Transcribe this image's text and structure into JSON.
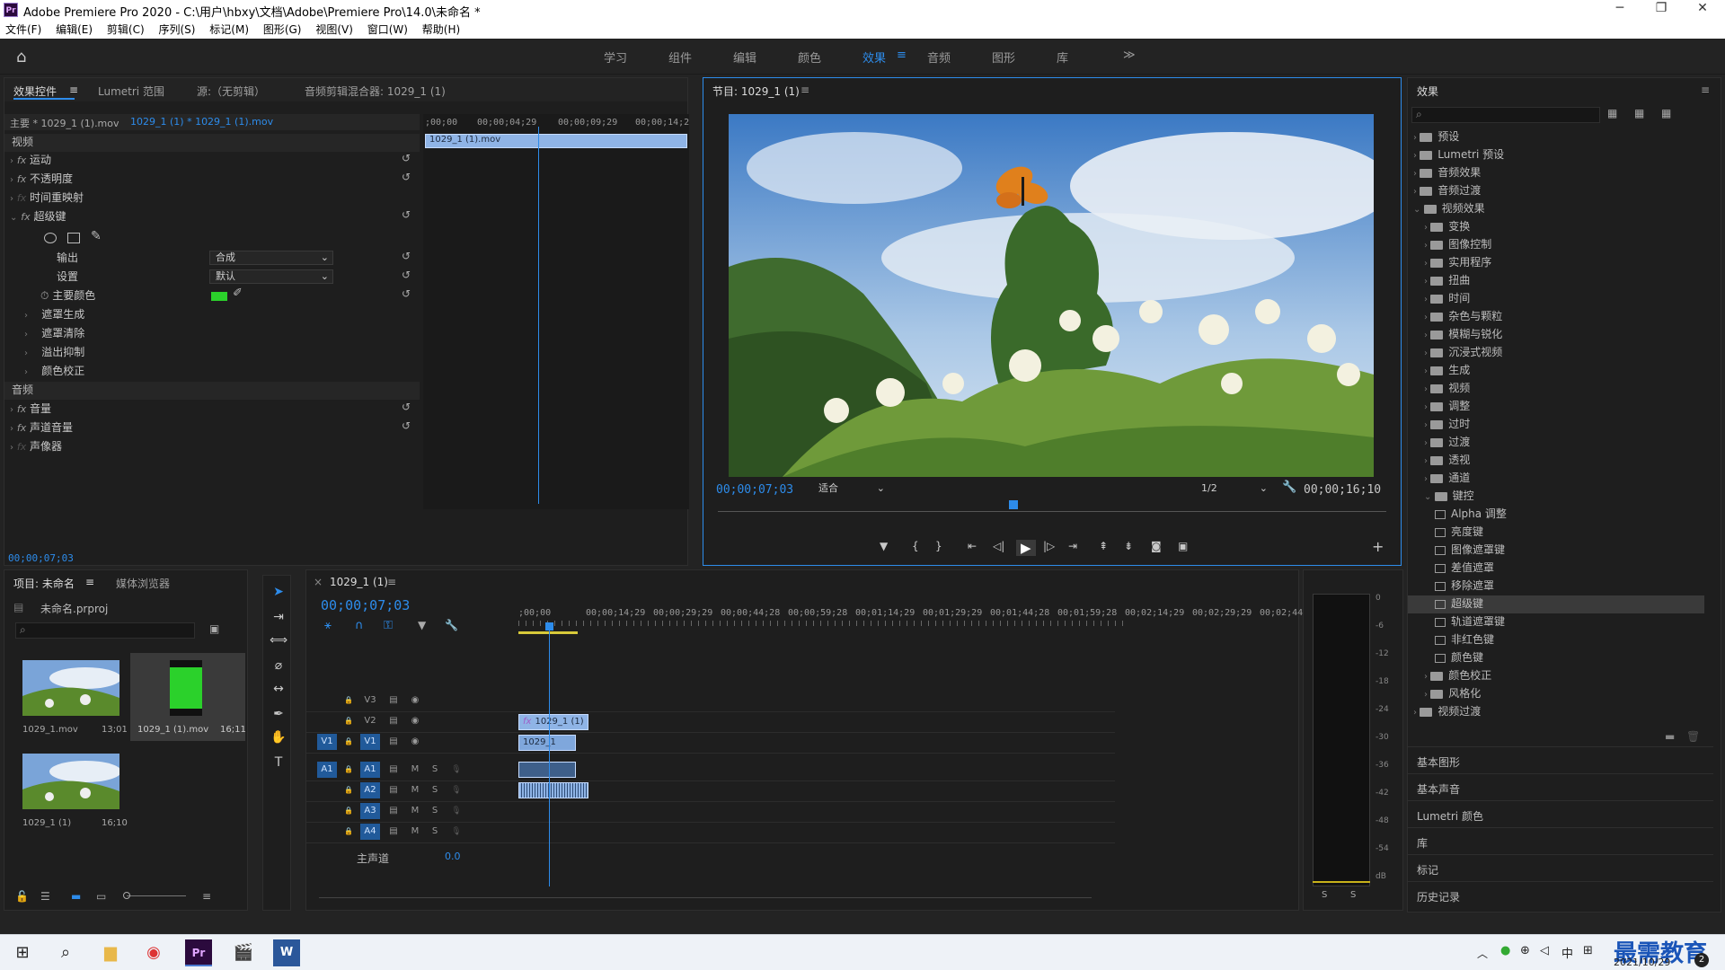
{
  "window": {
    "title": "Adobe Premiere Pro 2020 - C:\\用户\\hbxy\\文档\\Adobe\\Premiere Pro\\14.0\\未命名 *",
    "minimize": "─",
    "maximize": "❐",
    "close": "✕"
  },
  "menu": [
    "文件(F)",
    "编辑(E)",
    "剪辑(C)",
    "序列(S)",
    "标记(M)",
    "图形(G)",
    "视图(V)",
    "窗口(W)",
    "帮助(H)"
  ],
  "workspaces": [
    "学习",
    "组件",
    "编辑",
    "颜色",
    "效果",
    "音频",
    "图形",
    "库"
  ],
  "workspace_active": "效果",
  "workspace_menu": "≡",
  "workspace_more": "≫",
  "effect_controls": {
    "tabs": [
      "效果控件",
      "Lumetri 范围",
      "源:（无剪辑）",
      "音频剪辑混合器: 1029_1 (1)"
    ],
    "tab_menu": "≡",
    "master": "主要 * 1029_1 (1).mov",
    "sequence": "1029_1 (1) * 1029_1 (1).mov",
    "ruler": [
      ";00;00",
      "00;00;04;29",
      "00;00;09;29",
      "00;00;14;2"
    ],
    "clip_label": "1029_1 (1).mov",
    "video_header": "视频",
    "rows_video": [
      "运动",
      "不透明度",
      "时间重映射",
      "超级键"
    ],
    "output_label": "输出",
    "output_value": "合成",
    "setting_label": "设置",
    "setting_value": "默认",
    "key_color_label": "主要颜色",
    "sub_groups": [
      "遮罩生成",
      "遮罩清除",
      "溢出抑制",
      "颜色校正"
    ],
    "audio_header": "音频",
    "rows_audio": [
      "音量",
      "声道音量",
      "声像器"
    ],
    "timecode": "00;00;07;03",
    "key_color": "#2bd12b"
  },
  "program": {
    "title": "节目: 1029_1 (1)",
    "timecode": "00;00;07;03",
    "fit": "适合",
    "quality": "1/2",
    "duration": "00;00;16;10",
    "controls": [
      "marker-icon",
      "in-icon",
      "out-icon",
      "goto-in-icon",
      "step-back-icon",
      "play-icon",
      "step-forward-icon",
      "goto-out-icon",
      "lift-icon",
      "extract-icon",
      "export-frame-icon",
      "compare-icon"
    ]
  },
  "effects": {
    "title": "效果",
    "top_items": [
      "预设",
      "Lumetri 预设",
      "音频效果",
      "音频过渡",
      "视频效果"
    ],
    "video_effects": [
      "变换",
      "图像控制",
      "实用程序",
      "扭曲",
      "时间",
      "杂色与颗粒",
      "模糊与锐化",
      "沉浸式视频",
      "生成",
      "视频",
      "调整",
      "过时",
      "过渡",
      "透视",
      "通道",
      "键控"
    ],
    "keying": [
      "Alpha 调整",
      "亮度键",
      "图像遮罩键",
      "差值遮罩",
      "移除遮罩",
      "超级键",
      "轨道遮罩键",
      "非红色键",
      "颜色键"
    ],
    "keying_selected": "超级键",
    "after": [
      "颜色校正",
      "风格化"
    ],
    "last": "视频过渡",
    "side_panels": [
      "基本图形",
      "基本声音",
      "Lumetri 颜色",
      "库",
      "标记",
      "历史记录"
    ]
  },
  "project": {
    "tabs": [
      "项目: 未命名",
      "媒体浏览器"
    ],
    "file": "未命名.prproj",
    "items": [
      {
        "name": "1029_1.mov",
        "dur": "13;01"
      },
      {
        "name": "1029_1 (1).mov",
        "dur": "16;11"
      },
      {
        "name": "1029_1 (1)",
        "dur": "16;10"
      }
    ]
  },
  "timeline": {
    "tab": "1029_1 (1)",
    "close": "×",
    "timecode": "00;00;07;03",
    "ruler": [
      ";00;00",
      "00;00;14;29",
      "00;00;29;29",
      "00;00;44;28",
      "00;00;59;28",
      "00;01;14;29",
      "00;01;29;29",
      "00;01;44;28",
      "00;01;59;28",
      "00;02;14;29",
      "00;02;29;29",
      "00;02;44;"
    ],
    "video_tracks": [
      "V3",
      "V2",
      "V1"
    ],
    "audio_tracks": [
      "A1",
      "A2",
      "A3",
      "A4"
    ],
    "src_v": "V1",
    "src_a": "A1",
    "master": "主声道",
    "master_val": "0.0",
    "clip_v2": "1029_1 (1)",
    "clip_v1": "1029_1",
    "fx_badge": "fx",
    "track_m": "M",
    "track_s": "S"
  },
  "meters": [
    "0",
    "-6",
    "-12",
    "-18",
    "-24",
    "-30",
    "-36",
    "-42",
    "-48",
    "-54",
    "dB"
  ],
  "meter_solo": [
    "S",
    "S"
  ],
  "taskbar": {
    "time": "2021/10/29",
    "lang": "中",
    "watermark": "最需教育",
    "badge": "2"
  }
}
